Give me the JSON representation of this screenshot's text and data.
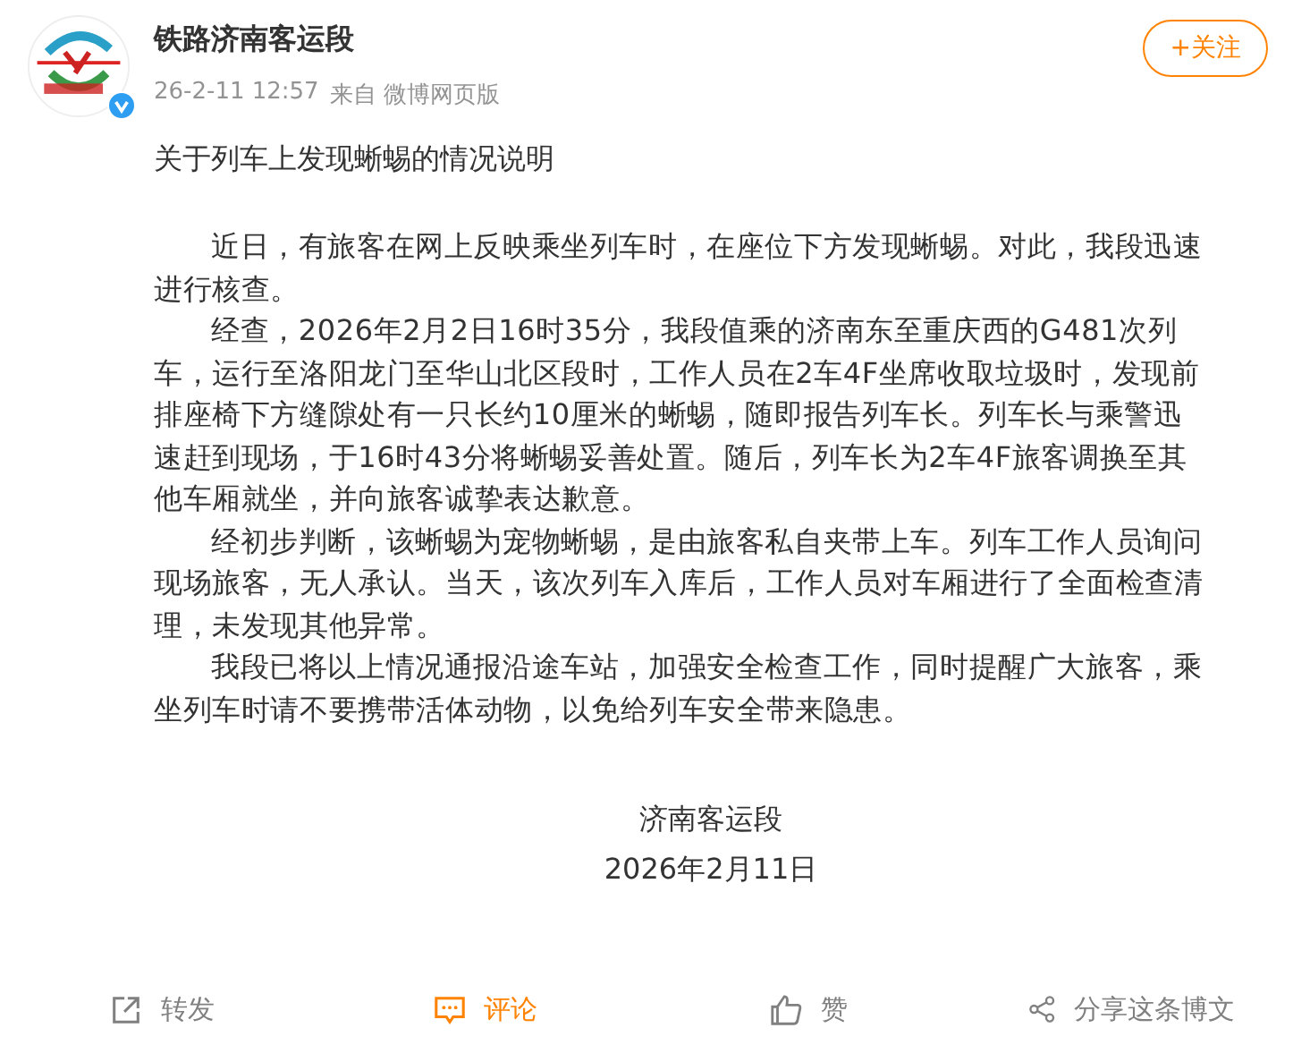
{
  "post": {
    "author": "铁路济南客运段",
    "verified": true,
    "time": "26-2-11 12:57",
    "source": "来自 微博网页版",
    "follow_button": "+关注",
    "title": "关于列车上发现蜥蜴的情况说明",
    "paragraphs": [
      "近日，有旅客在网上反映乘坐列车时，在座位下方发现蜥蜴。对此，我段迅速进行核查。",
      "经查，2026年2月2日16时35分，我段值乘的济南东至重庆西的G481次列车，运行至洛阳龙门至华山北区段时，工作人员在2车4F坐席收取垃圾时，发现前排座椅下方缝隙处有一只长约10厘米的蜥蜴，随即报告列车长。列车长与乘警迅速赶到现场，于16时43分将蜥蜴妥善处置。随后，列车长为2车4F旅客调换至其他车厢就坐，并向旅客诚挚表达歉意。",
      "经初步判断，该蜥蜴为宠物蜥蜴，是由旅客私自夹带上车。列车工作人员询问现场旅客，无人承认。当天，该次列车入库后，工作人员对车厢进行了全面检查清理，未发现其他异常。",
      "我段已将以上情况通报沿途车站，加强安全检查工作，同时提醒广大旅客，乘坐列车时请不要携带活体动物，以免给列车安全带来隐患。"
    ],
    "signature": "济南客运段",
    "date": "2026年2月11日"
  },
  "actions": [
    {
      "kind": "repost",
      "label": "转发",
      "selected": false
    },
    {
      "kind": "comment",
      "label": "评论",
      "selected": true
    },
    {
      "kind": "like",
      "label": "赞",
      "selected": false
    },
    {
      "kind": "share",
      "label": "分享这条博文",
      "selected": false
    }
  ]
}
